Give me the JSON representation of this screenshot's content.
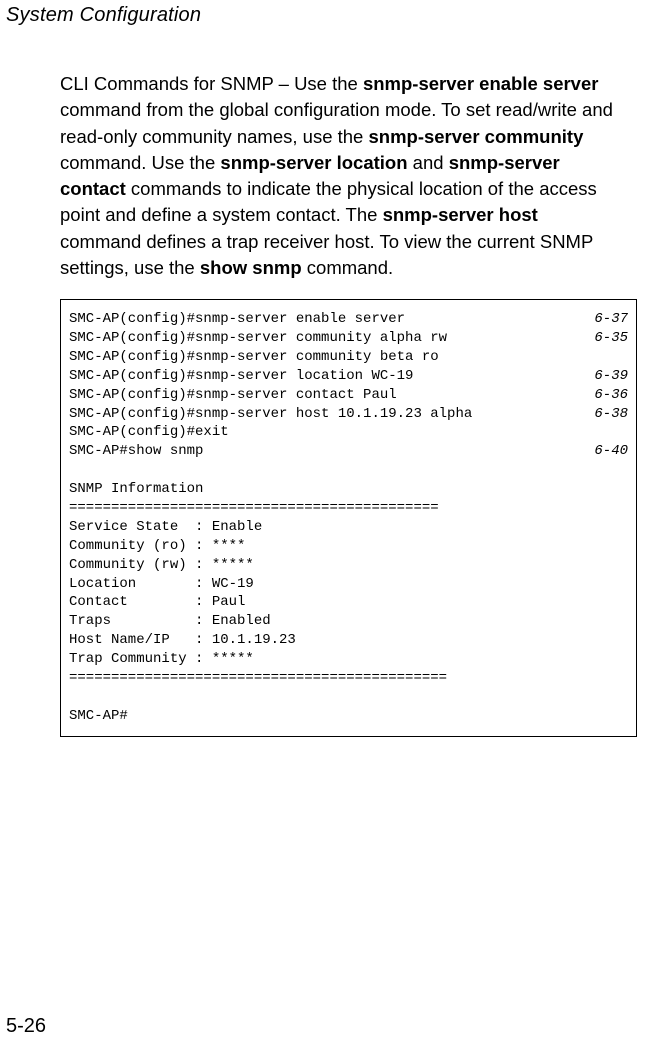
{
  "running_head": "System Configuration",
  "page_number": "5-26",
  "para": {
    "t1": "CLI Commands for SNMP – Use the ",
    "b1": "snmp-server enable server",
    "t2": " command from the global configuration mode. To set read/write and read-only community names, use the ",
    "b2": "snmp-server community",
    "t3": " command. Use the ",
    "b3": "snmp-server location",
    "t4": " and ",
    "b4": "snmp-server contact",
    "t5": " commands to indicate the physical location of the access point and define a system contact. The ",
    "b5": "snmp-server host",
    "t6": " command defines a trap receiver host. To view the current SNMP settings, use the ",
    "b6": "show snmp",
    "t7": " command."
  },
  "cli": {
    "lines": [
      {
        "text": "SMC-AP(config)#snmp-server enable server",
        "ref": "6-37"
      },
      {
        "text": "SMC-AP(config)#snmp-server community alpha rw",
        "ref": "6-35"
      },
      {
        "text": "SMC-AP(config)#snmp-server community beta ro",
        "ref": ""
      },
      {
        "text": "SMC-AP(config)#snmp-server location WC-19",
        "ref": "6-39"
      },
      {
        "text": "SMC-AP(config)#snmp-server contact Paul",
        "ref": "6-36"
      },
      {
        "text": "SMC-AP(config)#snmp-server host 10.1.19.23 alpha",
        "ref": "6-38"
      },
      {
        "text": "SMC-AP(config)#exit",
        "ref": ""
      },
      {
        "text": "SMC-AP#show snmp",
        "ref": "6-40"
      },
      {
        "text": "",
        "ref": ""
      },
      {
        "text": "SNMP Information",
        "ref": ""
      },
      {
        "text": "============================================",
        "ref": ""
      },
      {
        "text": "Service State  : Enable",
        "ref": ""
      },
      {
        "text": "Community (ro) : ****",
        "ref": ""
      },
      {
        "text": "Community (rw) : *****",
        "ref": ""
      },
      {
        "text": "Location       : WC-19",
        "ref": ""
      },
      {
        "text": "Contact        : Paul",
        "ref": ""
      },
      {
        "text": "Traps          : Enabled",
        "ref": ""
      },
      {
        "text": "Host Name/IP   : 10.1.19.23",
        "ref": ""
      },
      {
        "text": "Trap Community : *****",
        "ref": ""
      },
      {
        "text": "=============================================",
        "ref": ""
      },
      {
        "text": "",
        "ref": ""
      },
      {
        "text": "SMC-AP#",
        "ref": ""
      }
    ]
  }
}
